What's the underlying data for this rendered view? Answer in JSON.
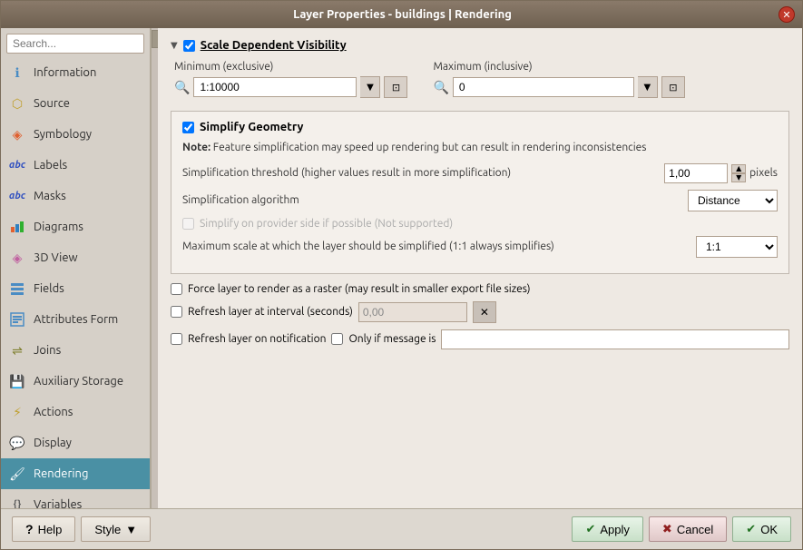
{
  "window": {
    "title": "Layer Properties - buildings | Rendering"
  },
  "sidebar": {
    "search_placeholder": "Search...",
    "items": [
      {
        "id": "information",
        "label": "Information",
        "icon": "ℹ"
      },
      {
        "id": "source",
        "label": "Source",
        "icon": "🔗"
      },
      {
        "id": "symbology",
        "label": "Symbology",
        "icon": "🎨"
      },
      {
        "id": "labels",
        "label": "Labels",
        "icon": "abc"
      },
      {
        "id": "masks",
        "label": "Masks",
        "icon": "abc"
      },
      {
        "id": "diagrams",
        "label": "Diagrams",
        "icon": "📊"
      },
      {
        "id": "3dview",
        "label": "3D View",
        "icon": "🔷"
      },
      {
        "id": "fields",
        "label": "Fields",
        "icon": "📋"
      },
      {
        "id": "attributes-form",
        "label": "Attributes Form",
        "icon": "📝"
      },
      {
        "id": "joins",
        "label": "Joins",
        "icon": "🔀"
      },
      {
        "id": "auxiliary-storage",
        "label": "Auxiliary Storage",
        "icon": "💾"
      },
      {
        "id": "actions",
        "label": "Actions",
        "icon": "⚡"
      },
      {
        "id": "display",
        "label": "Display",
        "icon": "💬"
      },
      {
        "id": "rendering",
        "label": "Rendering",
        "icon": "🖌",
        "active": true
      },
      {
        "id": "variables",
        "label": "Variables",
        "icon": "{}"
      }
    ]
  },
  "main": {
    "scale_visibility": {
      "header": "Scale Dependent Visibility",
      "checked": true,
      "minimum_label": "Minimum (exclusive)",
      "maximum_label": "Maximum (inclusive)",
      "minimum_value": "1:10000",
      "maximum_value": "0"
    },
    "simplify_geometry": {
      "header": "Simplify Geometry",
      "checked": true,
      "note_bold": "Note:",
      "note_text": " Feature simplification may speed up rendering but can result in rendering inconsistencies",
      "threshold_label": "Simplification threshold (higher values result in more simplification)",
      "threshold_value": "1,00",
      "threshold_unit": "pixels",
      "algorithm_label": "Simplification algorithm",
      "algorithm_value": "Distance",
      "provider_label": "Simplify on provider side if possible (Not supported)",
      "max_scale_label": "Maximum scale at which the layer should be simplified (1:1 always simplifies)",
      "max_scale_value": "1:1"
    },
    "options": {
      "force_raster_label": "Force layer to render as a raster (may result in smaller export file sizes)",
      "refresh_interval_label": "Refresh layer at interval (seconds)",
      "refresh_interval_value": "0,00",
      "refresh_notification_label": "Refresh layer on notification",
      "only_message_label": "Only if message is",
      "only_message_checked": false
    }
  },
  "bottom_bar": {
    "help_label": "Help",
    "style_label": "Style",
    "apply_label": "Apply",
    "cancel_label": "Cancel",
    "ok_label": "OK",
    "help_icon": "?",
    "apply_icon": "✔",
    "cancel_icon": "✖",
    "ok_icon": "✔"
  }
}
